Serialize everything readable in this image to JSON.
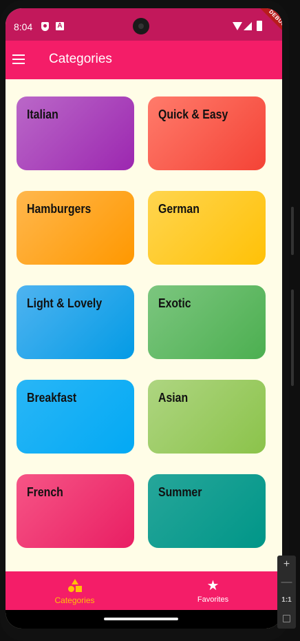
{
  "status_bar": {
    "time": "8:04",
    "debug_label": "DEBUG",
    "icons": [
      "shield-icon",
      "a-icon",
      "wifi-icon",
      "signal-icon",
      "battery-icon"
    ]
  },
  "app_bar": {
    "title": "Categories",
    "menu_icon": "menu-icon"
  },
  "categories": [
    {
      "label": "Italian",
      "color_start": "#BA68C8",
      "color_end": "#9C27B0"
    },
    {
      "label": "Quick & Easy",
      "color_start": "#FF7B6B",
      "color_end": "#F44336"
    },
    {
      "label": "Hamburgers",
      "color_start": "#FFB74D",
      "color_end": "#FF9800"
    },
    {
      "label": "German",
      "color_start": "#FFD54F",
      "color_end": "#FFC107"
    },
    {
      "label": "Light & Lovely",
      "color_start": "#4FB3F0",
      "color_end": "#039BE5"
    },
    {
      "label": "Exotic",
      "color_start": "#7CC67F",
      "color_end": "#4CAF50"
    },
    {
      "label": "Breakfast",
      "color_start": "#29B6F6",
      "color_end": "#03A9F4"
    },
    {
      "label": "Asian",
      "color_start": "#AED581",
      "color_end": "#8BC34A"
    },
    {
      "label": "French",
      "color_start": "#F65586",
      "color_end": "#E91E63"
    },
    {
      "label": "Summer",
      "color_start": "#26A69A",
      "color_end": "#009688"
    }
  ],
  "bottom_nav": {
    "items": [
      {
        "label": "Categories",
        "icon": "category-icon",
        "active": true
      },
      {
        "label": "Favorites",
        "icon": "star-icon",
        "active": false
      }
    ]
  },
  "emulator_panel": {
    "zoom_in": "+",
    "zoom_out": "—",
    "one_to_one": "1:1"
  },
  "colors": {
    "primary": "#F41D68",
    "status_bar": "#C2185B",
    "background": "#FFFDE7",
    "accent": "#FFC107"
  }
}
